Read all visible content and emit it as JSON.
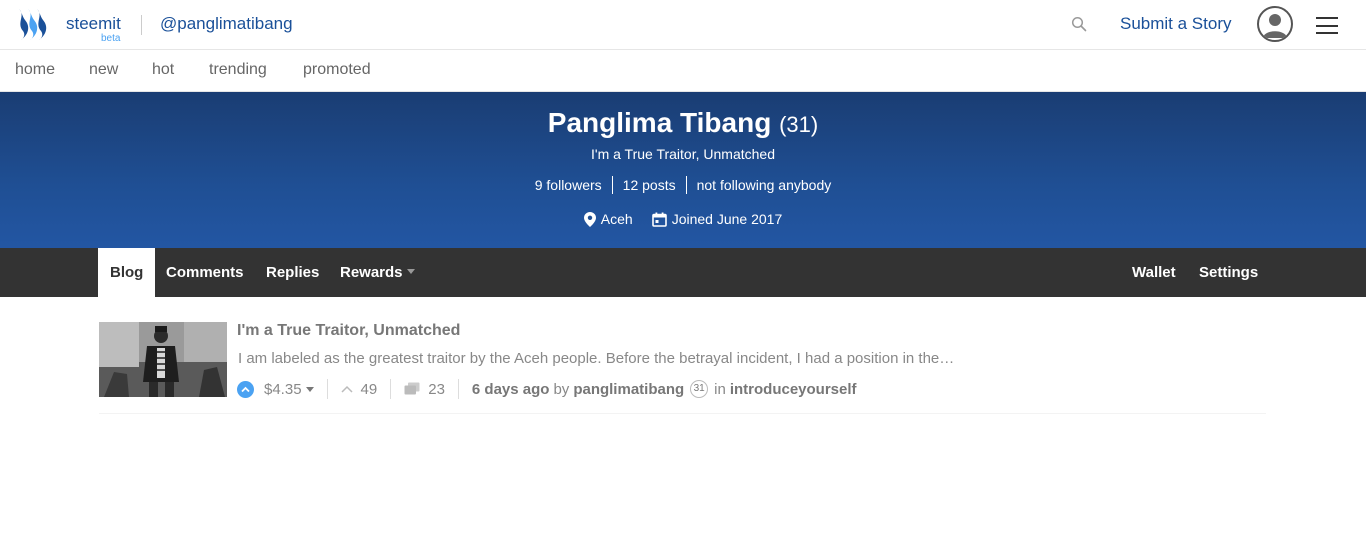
{
  "header": {
    "brand": "steemit",
    "beta": "beta",
    "user_handle": "@panglimatibang",
    "submit_label": "Submit a Story"
  },
  "subnav": [
    "home",
    "new",
    "hot",
    "trending",
    "promoted"
  ],
  "profile": {
    "name": "Panglima Tibang",
    "reputation": "(31)",
    "tagline": "I'm a True Traitor, Unmatched",
    "followers": "9 followers",
    "posts": "12 posts",
    "following": "not following anybody",
    "location": "Aceh",
    "joined": "Joined June 2017"
  },
  "tabs": {
    "blog": "Blog",
    "comments": "Comments",
    "replies": "Replies",
    "rewards": "Rewards",
    "wallet": "Wallet",
    "settings": "Settings"
  },
  "post": {
    "title": "I'm a True Traitor, Unmatched",
    "excerpt": "I am labeled as the greatest traitor by the Aceh people. Before the betrayal incident, I had a position in the…",
    "payout": "$4.35",
    "votes": "49",
    "comments": "23",
    "age": "6 days ago",
    "by": "by",
    "author": "panglimatibang",
    "author_rep": "31",
    "in": "in",
    "category": "introduceyourself"
  },
  "colors": {
    "brand_blue": "#1a5099",
    "upvote_blue": "#4ba2f2",
    "banner_top": "#1a3d73",
    "banner_bottom": "#2356a3",
    "tabs_bg": "#333333"
  }
}
